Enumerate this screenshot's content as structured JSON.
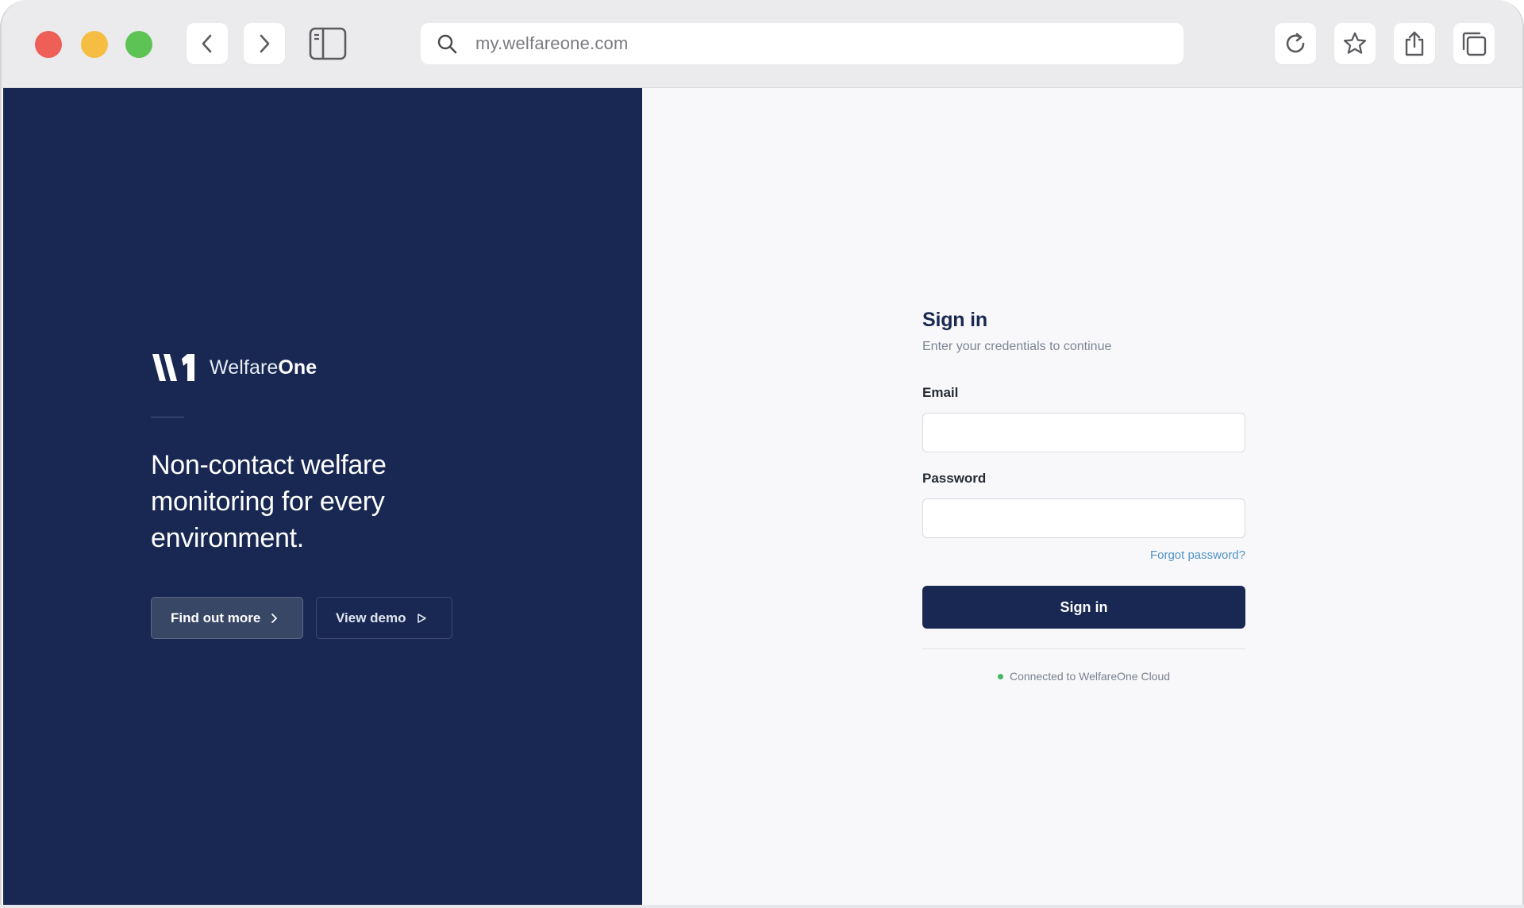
{
  "browser": {
    "url": "my.welfareone.com",
    "icons": {
      "back": "chevron-left-icon",
      "forward": "chevron-right-icon",
      "sidebar": "sidebar-icon",
      "search": "search-icon",
      "reload": "reload-icon",
      "bookmark": "star-icon",
      "share": "share-icon",
      "tabs": "tabs-icon"
    }
  },
  "hero": {
    "brand_light": "Welfare",
    "brand_bold": "One",
    "tagline": "Non-contact welfare monitoring for every environment.",
    "primary_cta": "Find out more",
    "secondary_cta": "View demo",
    "colors": {
      "background": "#182852",
      "primary_button": "#384766"
    }
  },
  "signin": {
    "title": "Sign in",
    "subtitle": "Enter your credentials to continue",
    "email_label": "Email",
    "email_value": "",
    "password_label": "Password",
    "password_value": "",
    "forgot_password": "Forgot password?",
    "submit_label": "Sign in",
    "status": "Connected to WelfareOne Cloud",
    "colors": {
      "accent": "#182852",
      "link": "#4f93c8",
      "status_dot": "#3fb964"
    }
  }
}
